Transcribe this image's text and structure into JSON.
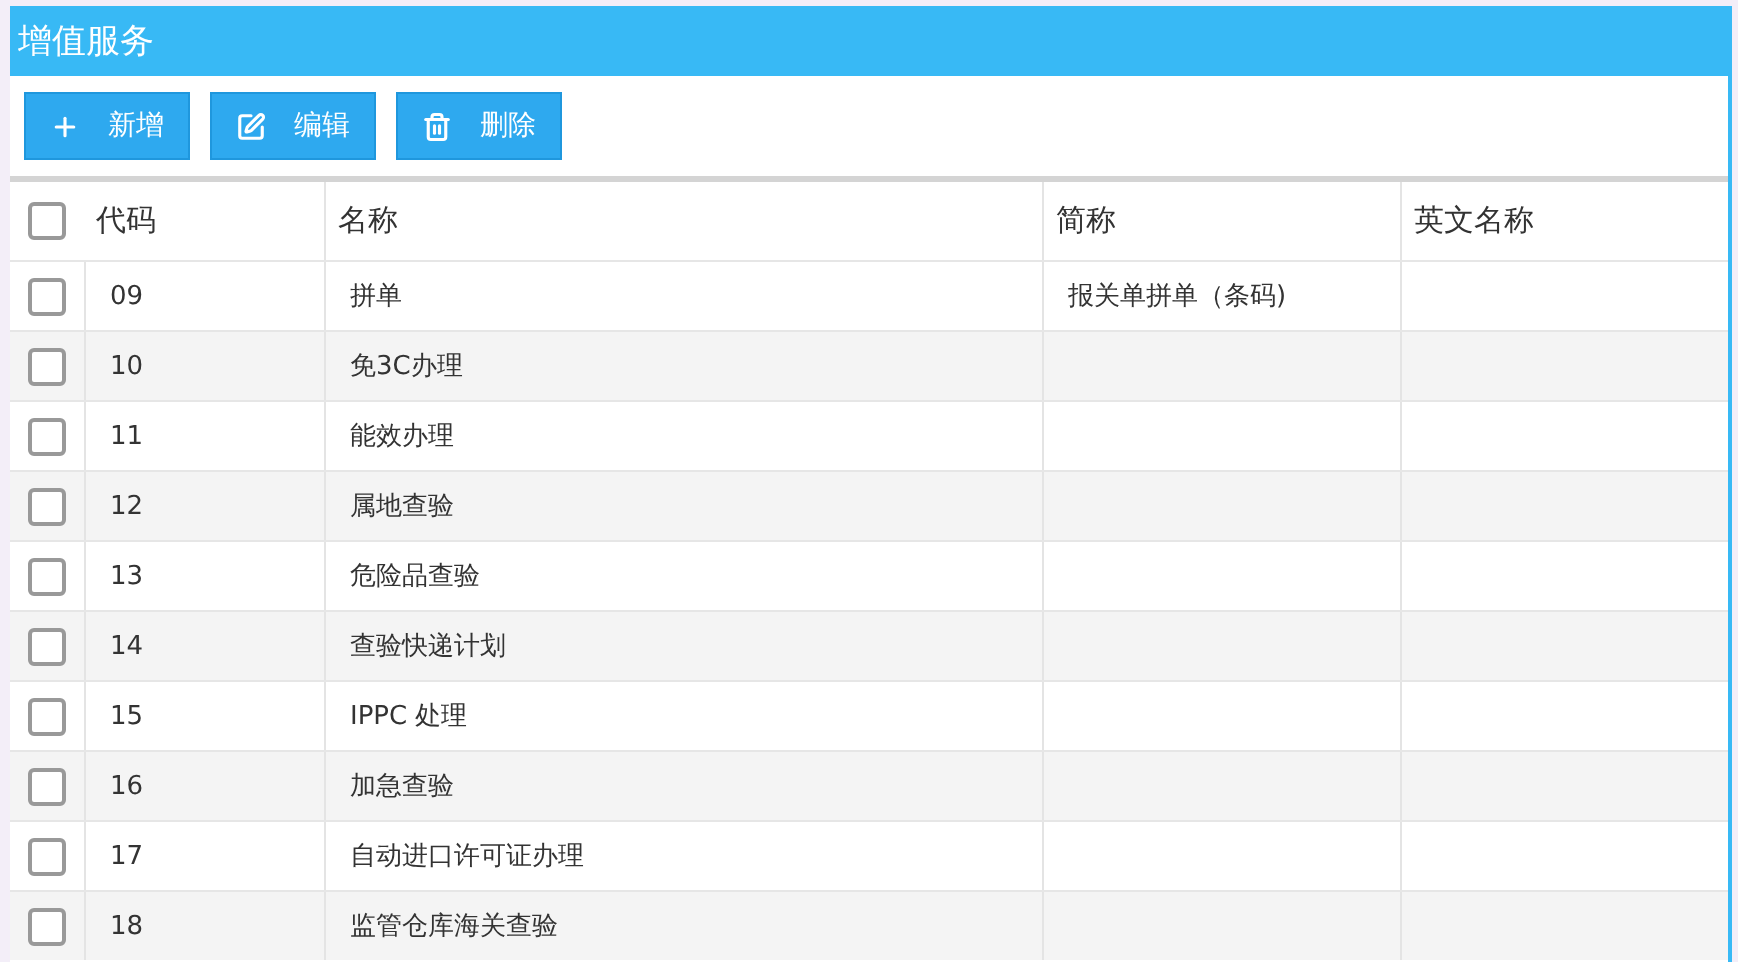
{
  "panel": {
    "title": "增值服务"
  },
  "toolbar": [
    {
      "kind": "add",
      "label": "新增"
    },
    {
      "kind": "edit",
      "label": "编辑"
    },
    {
      "kind": "delete",
      "label": "删除"
    }
  ],
  "table": {
    "select_all": {
      "checked": false
    },
    "columns": [
      "代码",
      "名称",
      "简称",
      "英文名称"
    ],
    "rows": [
      {
        "checked": false,
        "cells": [
          "09",
          "拼单",
          "报关单拼单（条码)",
          ""
        ]
      },
      {
        "checked": false,
        "cells": [
          "10",
          "免3C办理",
          "",
          ""
        ]
      },
      {
        "checked": false,
        "cells": [
          "11",
          "能效办理",
          "",
          ""
        ]
      },
      {
        "checked": false,
        "cells": [
          "12",
          "属地查验",
          "",
          ""
        ]
      },
      {
        "checked": false,
        "cells": [
          "13",
          "危险品查验",
          "",
          ""
        ]
      },
      {
        "checked": false,
        "cells": [
          "14",
          "查验快递计划",
          "",
          ""
        ]
      },
      {
        "checked": false,
        "cells": [
          "15",
          "IPPC 处理",
          "",
          ""
        ]
      },
      {
        "checked": false,
        "cells": [
          "16",
          "加急查验",
          "",
          ""
        ]
      },
      {
        "checked": false,
        "cells": [
          "17",
          "自动进口许可证办理",
          "",
          ""
        ]
      },
      {
        "checked": false,
        "cells": [
          "18",
          "监管仓库海关查验",
          "",
          ""
        ]
      }
    ]
  }
}
